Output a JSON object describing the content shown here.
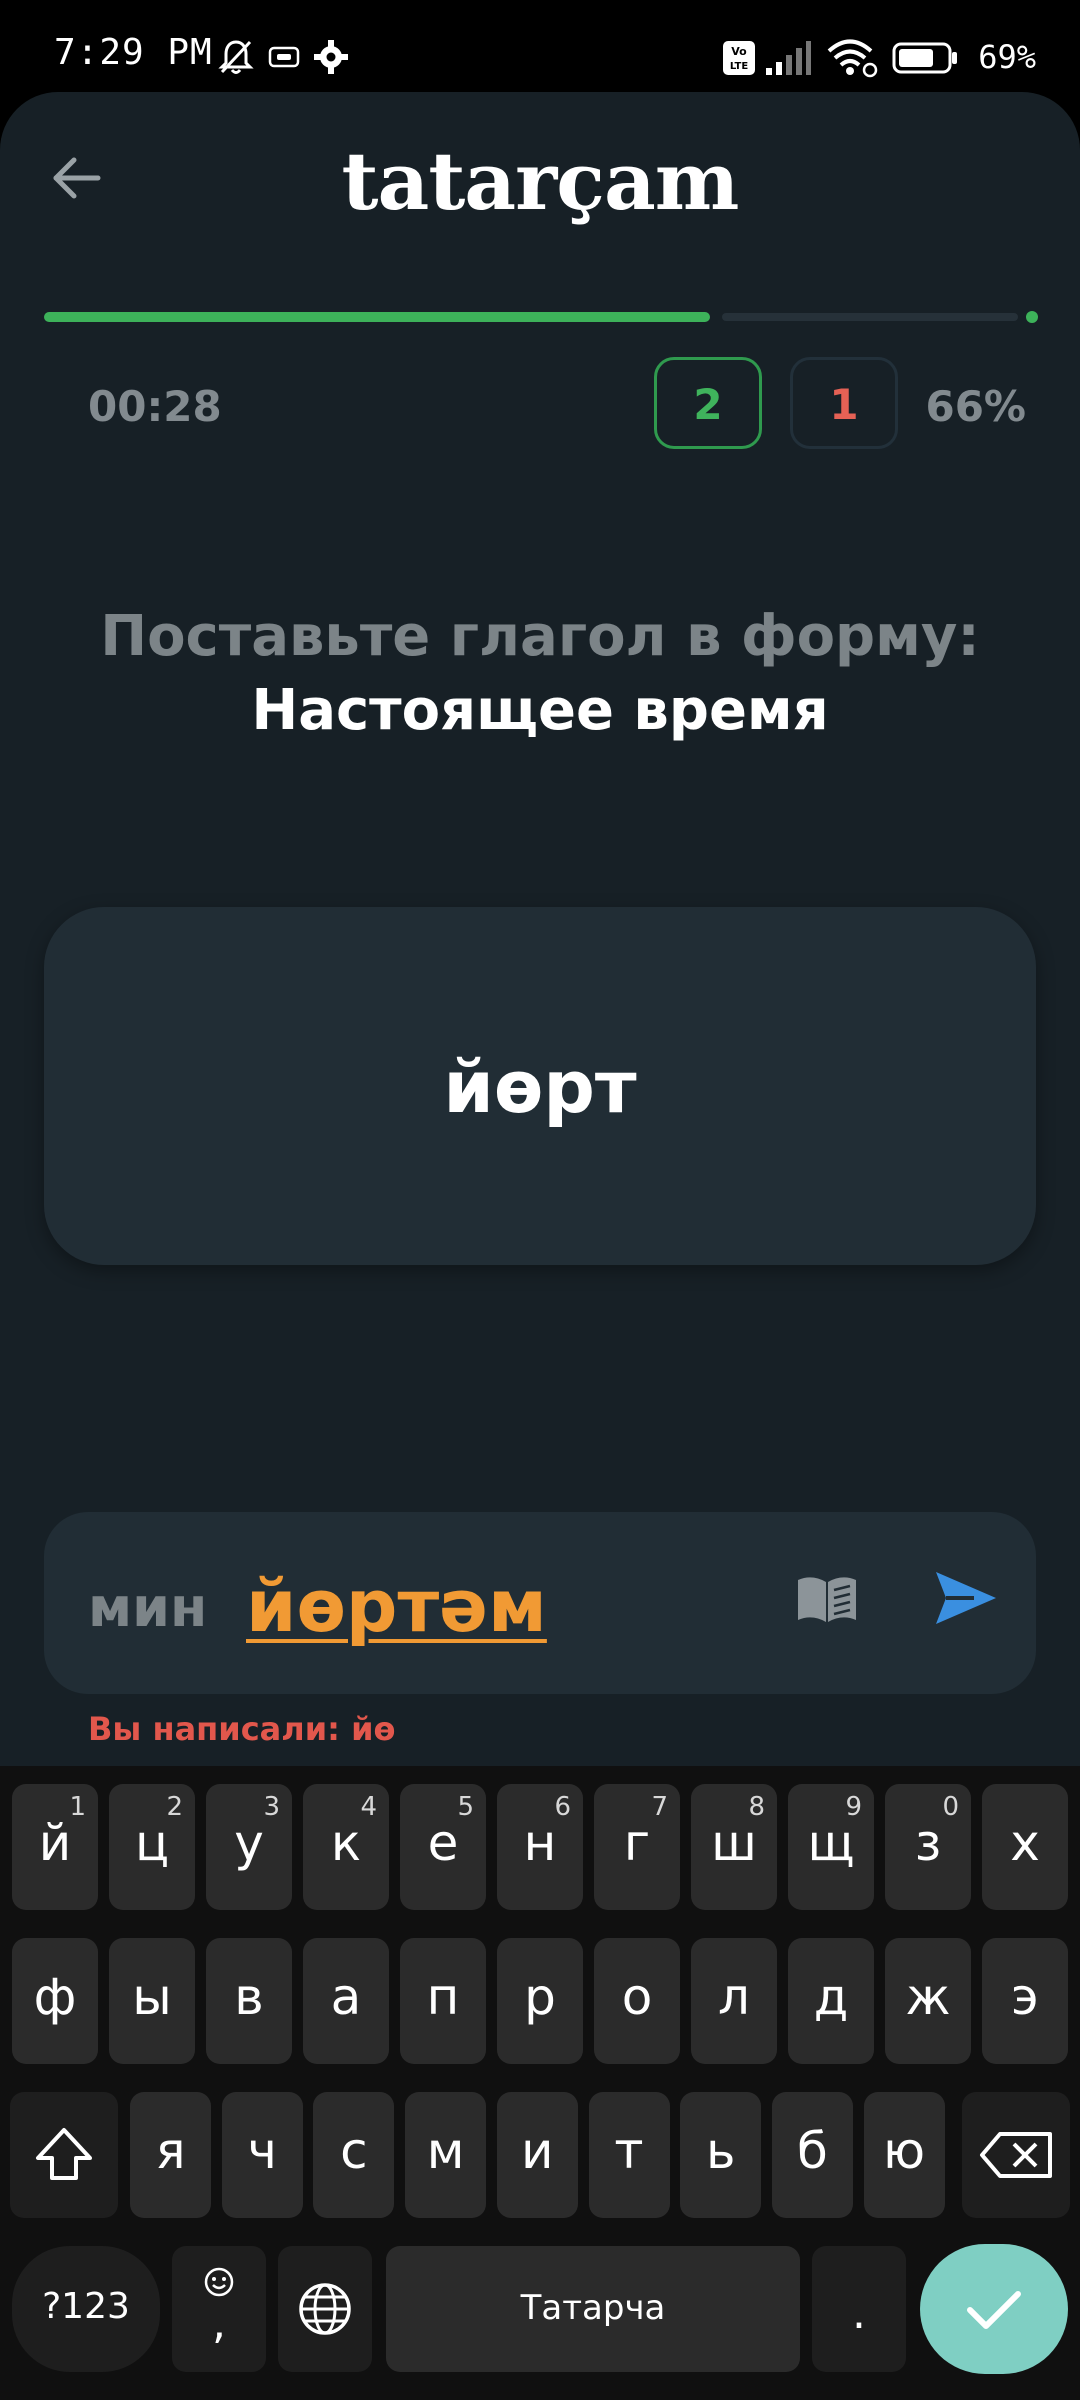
{
  "status_bar": {
    "time": "7:29 PM",
    "battery_percent": "69%"
  },
  "app": {
    "title": "tatarçam",
    "progress": 0.67,
    "timer": "00:28",
    "correct_count": "2",
    "wrong_count": "1",
    "accuracy": "66%",
    "prompt": "Поставьте глагол в форму:",
    "tense": "Настоящее время",
    "word": "йөрт",
    "pronoun": "мин",
    "answer": "йөртәм",
    "you_wrote": "Вы написали: йө"
  },
  "keyboard": {
    "row1": [
      {
        "label": "й",
        "hint": "1"
      },
      {
        "label": "ц",
        "hint": "2"
      },
      {
        "label": "у",
        "hint": "3"
      },
      {
        "label": "к",
        "hint": "4"
      },
      {
        "label": "е",
        "hint": "5"
      },
      {
        "label": "н",
        "hint": "6"
      },
      {
        "label": "г",
        "hint": "7"
      },
      {
        "label": "ш",
        "hint": "8"
      },
      {
        "label": "щ",
        "hint": "9"
      },
      {
        "label": "з",
        "hint": "0"
      },
      {
        "label": "х",
        "hint": ""
      }
    ],
    "row2": [
      "ф",
      "ы",
      "в",
      "а",
      "п",
      "р",
      "о",
      "л",
      "д",
      "ж",
      "э"
    ],
    "row3": [
      "я",
      "ч",
      "с",
      "м",
      "и",
      "т",
      "ь",
      "б",
      "ю"
    ],
    "symbols_label": "?123",
    "comma_label": ",",
    "space_label": "Татарча",
    "period_label": "."
  },
  "colors": {
    "accent_green": "#3db25a",
    "error_red": "#e2574c",
    "answer_orange": "#f19a34",
    "send_blue": "#3a8fe0",
    "enter_teal": "#7fcfc3"
  }
}
